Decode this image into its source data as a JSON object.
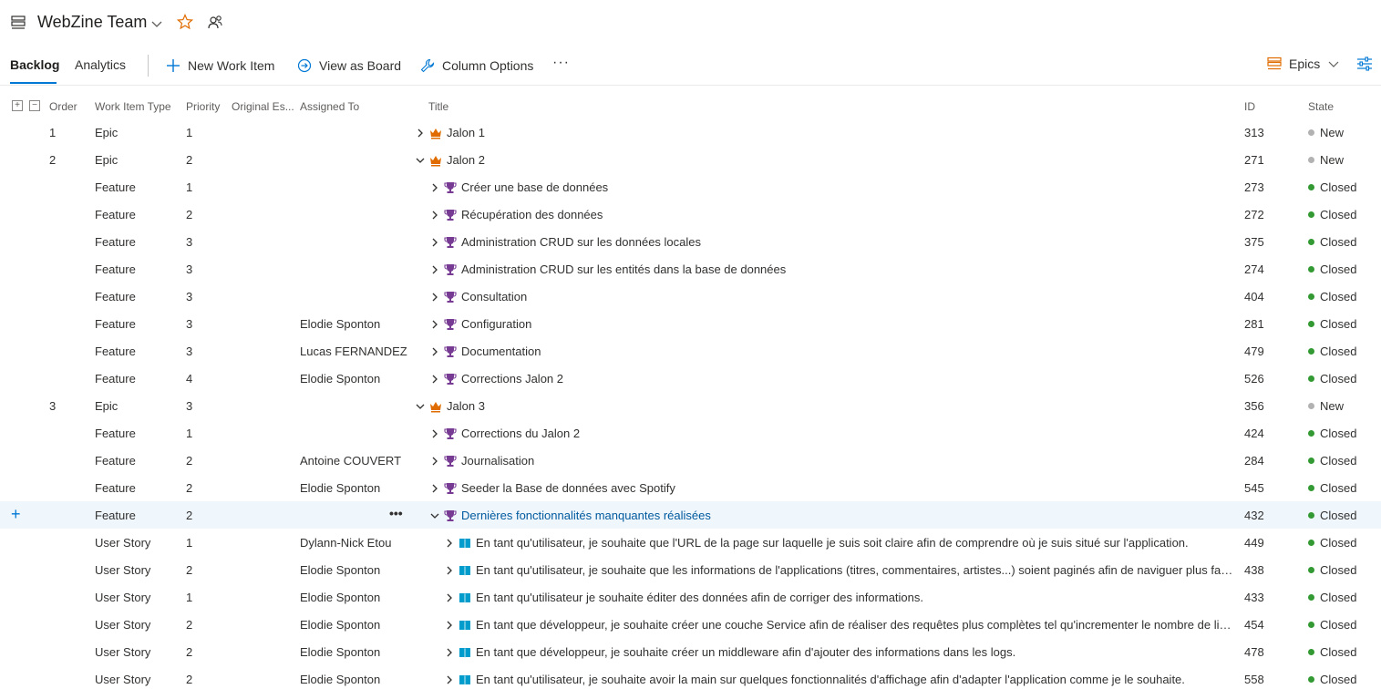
{
  "header": {
    "team_name": "WebZine Team",
    "icons": [
      "backlog-icon",
      "chevron-down-icon",
      "star-icon",
      "people-icon"
    ]
  },
  "toolbar": {
    "tabs": [
      {
        "label": "Backlog",
        "active": true
      },
      {
        "label": "Analytics",
        "active": false
      }
    ],
    "new_work_item": "New Work Item",
    "view_as_board": "View as Board",
    "column_options": "Column Options",
    "more": "···",
    "level": "Epics"
  },
  "colors": {
    "accent": "#0078d4",
    "epic": "#e06c00",
    "feature": "#773b93",
    "user_story": "#009ccc",
    "state_new": "#b2b2b2",
    "state_closed": "#339933"
  },
  "columns": {
    "order": "Order",
    "type": "Work Item Type",
    "priority": "Priority",
    "estimate": "Original Es...",
    "assigned": "Assigned To",
    "title": "Title",
    "id": "ID",
    "state": "State"
  },
  "rows": [
    {
      "order": "1",
      "type": "Epic",
      "priority": "1",
      "assigned": "",
      "title": "Jalon 1",
      "id": "313",
      "state": "New",
      "level": 0,
      "expanded": false
    },
    {
      "order": "2",
      "type": "Epic",
      "priority": "2",
      "assigned": "",
      "title": "Jalon 2",
      "id": "271",
      "state": "New",
      "level": 0,
      "expanded": true
    },
    {
      "order": "",
      "type": "Feature",
      "priority": "1",
      "assigned": "",
      "title": "Créer une base de données",
      "id": "273",
      "state": "Closed",
      "level": 1,
      "expanded": false
    },
    {
      "order": "",
      "type": "Feature",
      "priority": "2",
      "assigned": "",
      "title": "Récupération des données",
      "id": "272",
      "state": "Closed",
      "level": 1,
      "expanded": false
    },
    {
      "order": "",
      "type": "Feature",
      "priority": "3",
      "assigned": "",
      "title": "Administration CRUD sur les données locales",
      "id": "375",
      "state": "Closed",
      "level": 1,
      "expanded": false
    },
    {
      "order": "",
      "type": "Feature",
      "priority": "3",
      "assigned": "",
      "title": "Administration CRUD sur les entités dans la base de données",
      "id": "274",
      "state": "Closed",
      "level": 1,
      "expanded": false
    },
    {
      "order": "",
      "type": "Feature",
      "priority": "3",
      "assigned": "",
      "title": "Consultation",
      "id": "404",
      "state": "Closed",
      "level": 1,
      "expanded": false
    },
    {
      "order": "",
      "type": "Feature",
      "priority": "3",
      "assigned": "Elodie Sponton",
      "title": "Configuration",
      "id": "281",
      "state": "Closed",
      "level": 1,
      "expanded": false
    },
    {
      "order": "",
      "type": "Feature",
      "priority": "3",
      "assigned": "Lucas FERNANDEZ",
      "title": "Documentation",
      "id": "479",
      "state": "Closed",
      "level": 1,
      "expanded": false
    },
    {
      "order": "",
      "type": "Feature",
      "priority": "4",
      "assigned": "Elodie Sponton",
      "title": "Corrections Jalon 2",
      "id": "526",
      "state": "Closed",
      "level": 1,
      "expanded": false
    },
    {
      "order": "3",
      "type": "Epic",
      "priority": "3",
      "assigned": "",
      "title": "Jalon 3",
      "id": "356",
      "state": "New",
      "level": 0,
      "expanded": true
    },
    {
      "order": "",
      "type": "Feature",
      "priority": "1",
      "assigned": "",
      "title": "Corrections du Jalon 2",
      "id": "424",
      "state": "Closed",
      "level": 1,
      "expanded": false
    },
    {
      "order": "",
      "type": "Feature",
      "priority": "2",
      "assigned": "Antoine COUVERT",
      "title": "Journalisation",
      "id": "284",
      "state": "Closed",
      "level": 1,
      "expanded": false
    },
    {
      "order": "",
      "type": "Feature",
      "priority": "2",
      "assigned": "Elodie Sponton",
      "title": "Seeder la Base de données avec Spotify",
      "id": "545",
      "state": "Closed",
      "level": 1,
      "expanded": false
    },
    {
      "order": "",
      "type": "Feature",
      "priority": "2",
      "assigned": "",
      "title": "Dernières fonctionnalités manquantes réalisées",
      "id": "432",
      "state": "Closed",
      "level": 1,
      "expanded": true,
      "selected": true
    },
    {
      "order": "",
      "type": "User Story",
      "priority": "1",
      "assigned": "Dylann-Nick Etou",
      "title": "En tant qu'utilisateur, je souhaite que l'URL de la page sur laquelle je suis soit claire afin de comprendre où je suis situé sur l'application.",
      "id": "449",
      "state": "Closed",
      "level": 2,
      "expanded": false
    },
    {
      "order": "",
      "type": "User Story",
      "priority": "2",
      "assigned": "Elodie Sponton",
      "title": "En tant qu'utilisateur, je souhaite que les informations de l'applications (titres, commentaires, artistes...) soient paginés afin de naviguer plus facilement.",
      "id": "438",
      "state": "Closed",
      "level": 2,
      "expanded": false
    },
    {
      "order": "",
      "type": "User Story",
      "priority": "1",
      "assigned": "Elodie Sponton",
      "title": "En tant qu'utilisateur je souhaite éditer des données afin de corriger des informations.",
      "id": "433",
      "state": "Closed",
      "level": 2,
      "expanded": false
    },
    {
      "order": "",
      "type": "User Story",
      "priority": "2",
      "assigned": "Elodie Sponton",
      "title": "En tant que développeur, je souhaite créer une couche Service afin de réaliser des requêtes plus complètes tel qu'incrementer le nombre de likes.",
      "id": "454",
      "state": "Closed",
      "level": 2,
      "expanded": false
    },
    {
      "order": "",
      "type": "User Story",
      "priority": "2",
      "assigned": "Elodie Sponton",
      "title": "En tant que développeur, je souhaite créer un middleware afin d'ajouter des informations dans les logs.",
      "id": "478",
      "state": "Closed",
      "level": 2,
      "expanded": false
    },
    {
      "order": "",
      "type": "User Story",
      "priority": "2",
      "assigned": "Elodie Sponton",
      "title": "En tant qu'utilisateur, je souhaite avoir la main sur quelques fonctionnalités d'affichage afin d'adapter l'application comme je le souhaite.",
      "id": "558",
      "state": "Closed",
      "level": 2,
      "expanded": false
    }
  ]
}
